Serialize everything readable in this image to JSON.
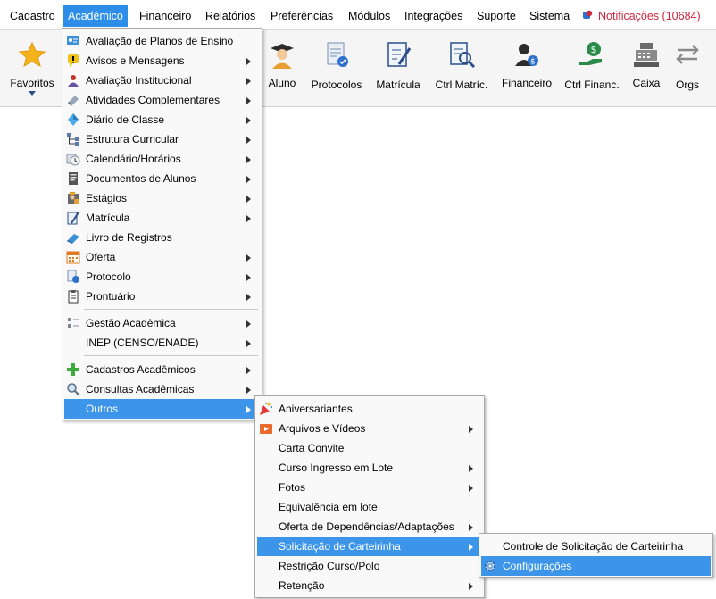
{
  "menubar": {
    "items": [
      {
        "label": "Cadastro"
      },
      {
        "label": "Acadêmico"
      },
      {
        "label": "Financeiro"
      },
      {
        "label": "Relatórios"
      },
      {
        "label": "Preferências"
      },
      {
        "label": "Módulos"
      },
      {
        "label": "Integrações"
      },
      {
        "label": "Suporte"
      },
      {
        "label": "Sistema"
      }
    ],
    "notifications": "Notificações (10684)"
  },
  "toolbar": {
    "buttons": [
      {
        "label": "Favoritos",
        "icon": "star-icon"
      },
      {
        "label": "Aluno",
        "icon": "student-icon"
      },
      {
        "label": "Protocolos",
        "icon": "protocol-icon"
      },
      {
        "label": "Matrícula",
        "icon": "enrollment-icon"
      },
      {
        "label": "Ctrl Matríc.",
        "icon": "enrollment-control-icon"
      },
      {
        "label": "Financeiro",
        "icon": "finance-user-icon"
      },
      {
        "label": "Ctrl Financ.",
        "icon": "finance-control-icon"
      },
      {
        "label": "Caixa",
        "icon": "cash-register-icon"
      },
      {
        "label": "Orgs",
        "icon": "swap-arrows-icon"
      }
    ]
  },
  "menu_academico": {
    "items": [
      {
        "label": "Avaliação de Planos de Ensino",
        "submenu": false
      },
      {
        "label": "Avisos e Mensagens",
        "submenu": true
      },
      {
        "label": "Avaliação Institucional",
        "submenu": true
      },
      {
        "label": "Atividades Complementares",
        "submenu": true
      },
      {
        "label": "Diário de Classe",
        "submenu": true
      },
      {
        "label": "Estrutura Curricular",
        "submenu": true
      },
      {
        "label": "Calendário/Horários",
        "submenu": true
      },
      {
        "label": "Documentos de Alunos",
        "submenu": true
      },
      {
        "label": "Estágios",
        "submenu": true
      },
      {
        "label": "Matrícula",
        "submenu": true
      },
      {
        "label": "Livro de Registros",
        "submenu": false
      },
      {
        "label": "Oferta",
        "submenu": true
      },
      {
        "label": "Protocolo",
        "submenu": true
      },
      {
        "label": "Prontuário",
        "submenu": true
      },
      {
        "label": "Gestão Acadêmica",
        "submenu": true
      },
      {
        "label": "INEP (CENSO/ENADE)",
        "submenu": true
      },
      {
        "label": "Cadastros Acadêmicos",
        "submenu": true
      },
      {
        "label": "Consultas Acadêmicas",
        "submenu": true
      },
      {
        "label": "Outros",
        "submenu": true
      }
    ]
  },
  "menu_outros": {
    "items": [
      {
        "label": "Aniversariantes",
        "submenu": false
      },
      {
        "label": "Arquivos e Vídeos",
        "submenu": true
      },
      {
        "label": "Carta Convite",
        "submenu": false
      },
      {
        "label": "Curso Ingresso em Lote",
        "submenu": true
      },
      {
        "label": "Fotos",
        "submenu": true
      },
      {
        "label": "Equivalência em lote",
        "submenu": false
      },
      {
        "label": "Oferta de Dependências/Adaptações",
        "submenu": true
      },
      {
        "label": "Solicitação de Carteirinha",
        "submenu": true
      },
      {
        "label": "Restrição Curso/Polo",
        "submenu": false
      },
      {
        "label": "Retenção",
        "submenu": true
      }
    ]
  },
  "menu_carteirinha": {
    "items": [
      {
        "label": "Controle de Solicitação de Carteirinha"
      },
      {
        "label": "Configurações"
      }
    ]
  },
  "colors": {
    "highlight": "#3d95ea",
    "menubar_active": "#2d8ee9",
    "notification": "#d0263b"
  }
}
